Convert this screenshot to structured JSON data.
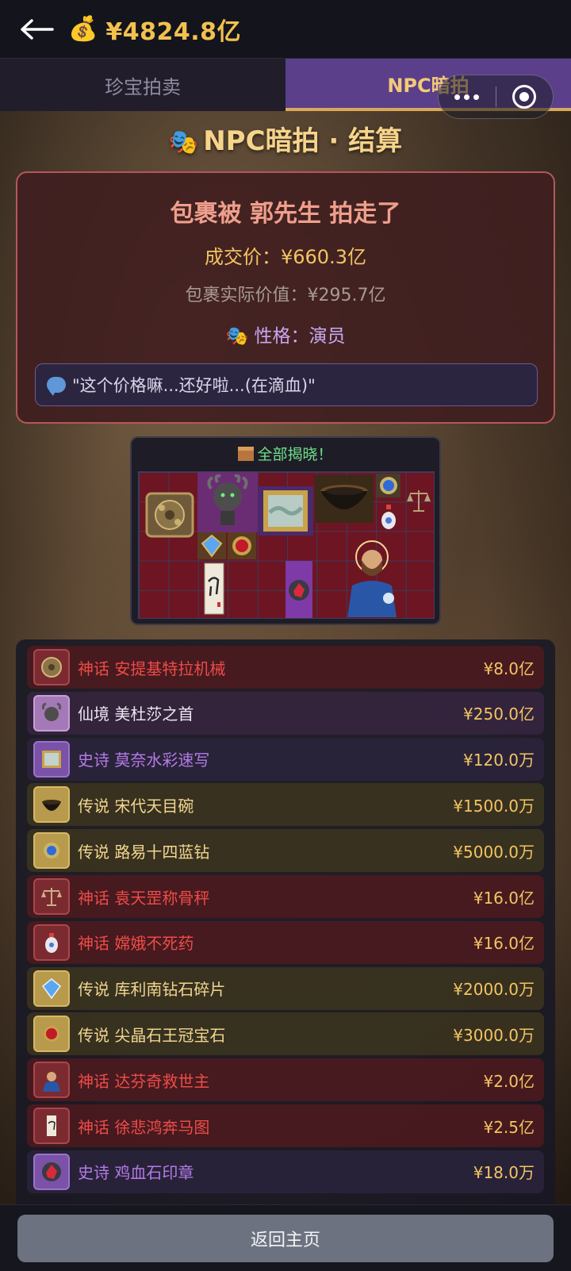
{
  "header": {
    "balance": "¥4824.8亿",
    "back_icon": "back-arrow-icon",
    "money_icon": "money-bag-icon",
    "money_glyph": "💰"
  },
  "tabs": [
    {
      "label": "珍宝拍卖",
      "active": false
    },
    {
      "label": "NPC暗拍",
      "active": true
    }
  ],
  "page": {
    "title": "NPC暗拍 · 结算",
    "title_icon": "theater-masks-icon",
    "title_glyph": "🎭"
  },
  "result": {
    "headline": "包裹被 郭先生 拍走了",
    "deal_price": "成交价：¥660.3亿",
    "actual_value": "包裹实际价值：¥295.7亿",
    "personality": "性格：演员",
    "personality_glyph": "🎭",
    "quote": "\"这个价格嘛...还好啦...(在滴血)\""
  },
  "reveal": {
    "title": "全部揭晓！",
    "title_icon": "package-icon"
  },
  "items": [
    {
      "tier": "神话",
      "name": "安提基特拉机械",
      "price": "¥8.0亿",
      "tier_class": "r-myth",
      "icon": "antikythera-gear-icon"
    },
    {
      "tier": "仙境",
      "name": "美杜莎之首",
      "price": "¥250.0亿",
      "tier_class": "r-fairy",
      "icon": "medusa-head-icon"
    },
    {
      "tier": "史诗",
      "name": "莫奈水彩速写",
      "price": "¥120.0万",
      "tier_class": "r-epic",
      "icon": "framed-painting-icon"
    },
    {
      "tier": "传说",
      "name": "宋代天目碗",
      "price": "¥1500.0万",
      "tier_class": "r-legend",
      "icon": "tea-bowl-icon"
    },
    {
      "tier": "传说",
      "name": "路易十四蓝钻",
      "price": "¥5000.0万",
      "tier_class": "r-legend",
      "icon": "blue-diamond-icon"
    },
    {
      "tier": "神话",
      "name": "袁天罡称骨秤",
      "price": "¥16.0亿",
      "tier_class": "r-myth",
      "icon": "balance-scale-icon"
    },
    {
      "tier": "神话",
      "name": "嫦娥不死药",
      "price": "¥16.0亿",
      "tier_class": "r-myth",
      "icon": "elixir-bottle-icon"
    },
    {
      "tier": "传说",
      "name": "库利南钻石碎片",
      "price": "¥2000.0万",
      "tier_class": "r-legend",
      "icon": "diamond-shard-icon"
    },
    {
      "tier": "传说",
      "name": "尖晶石王冠宝石",
      "price": "¥3000.0万",
      "tier_class": "r-legend",
      "icon": "red-gem-icon"
    },
    {
      "tier": "神话",
      "name": "达芬奇救世主",
      "price": "¥2.0亿",
      "tier_class": "r-myth",
      "icon": "salvator-mundi-icon"
    },
    {
      "tier": "神话",
      "name": "徐悲鸿奔马图",
      "price": "¥2.5亿",
      "tier_class": "r-myth",
      "icon": "horse-scroll-icon"
    },
    {
      "tier": "史诗",
      "name": "鸡血石印章",
      "price": "¥18.0万",
      "tier_class": "r-epic",
      "icon": "bloodstone-seal-icon"
    }
  ],
  "footer": {
    "home_button": "返回主页"
  },
  "colors": {
    "gold": "#f3c462",
    "myth": "#ee4b48",
    "epic": "#b47ae6",
    "legend": "#f2d690",
    "active_tab": "#5b3f8a"
  }
}
